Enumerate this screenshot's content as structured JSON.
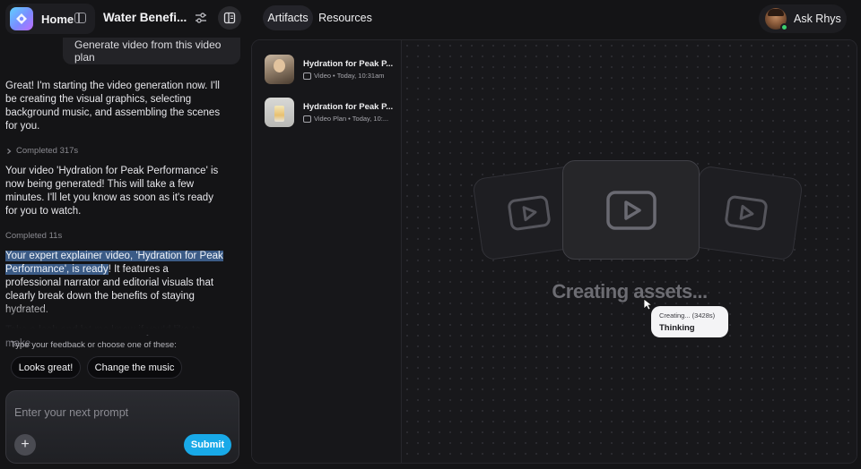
{
  "topbar": {
    "home_label": "Home",
    "project_title": "Water Benefi...",
    "tabs": [
      {
        "label": "Artifacts",
        "active": true
      },
      {
        "label": "Resources",
        "active": false
      }
    ],
    "user_name": "Ask Rhys"
  },
  "chat": {
    "user_message": "Generate video from this video plan",
    "messages": [
      "Great! I'm starting the video generation now. I'll be creating the visual graphics, selecting background music, and assembling the scenes for you.",
      "Completed 317s",
      "Your video 'Hydration for Peak Performance' is now being generated! This will take a few minutes. I'll let you know as soon as it's ready for you to watch.",
      "Completed 11s"
    ],
    "final_message": {
      "highlighted": "Your expert explainer video, 'Hydration for Peak Performance', is ready",
      "rest": "! It features a professional narrator and editorial visuals that clearly break down the benefits of staying hydrated.",
      "faded": "Take a look and let me know if you'd like to make"
    },
    "hint": "Type your feedback or choose one of these:",
    "suggestions": [
      "Looks great!",
      "Change the music"
    ],
    "prompt_placeholder": "Enter your next prompt",
    "submit_label": "Submit"
  },
  "artifacts": {
    "items": [
      {
        "title": "Hydration for Peak P...",
        "type": "Video",
        "time": "Today, 10:31am"
      },
      {
        "title": "Hydration for Peak P...",
        "type": "Video Plan",
        "time": "Today, 10:..."
      }
    ],
    "canvas": {
      "title": "Creating assets...",
      "bubble_top": "Creating... (3428s)",
      "bubble_main": "Thinking"
    }
  },
  "colors": {
    "accent": "#18a9e8",
    "highlight": "#3b5b86",
    "online": "#3bd16f"
  }
}
